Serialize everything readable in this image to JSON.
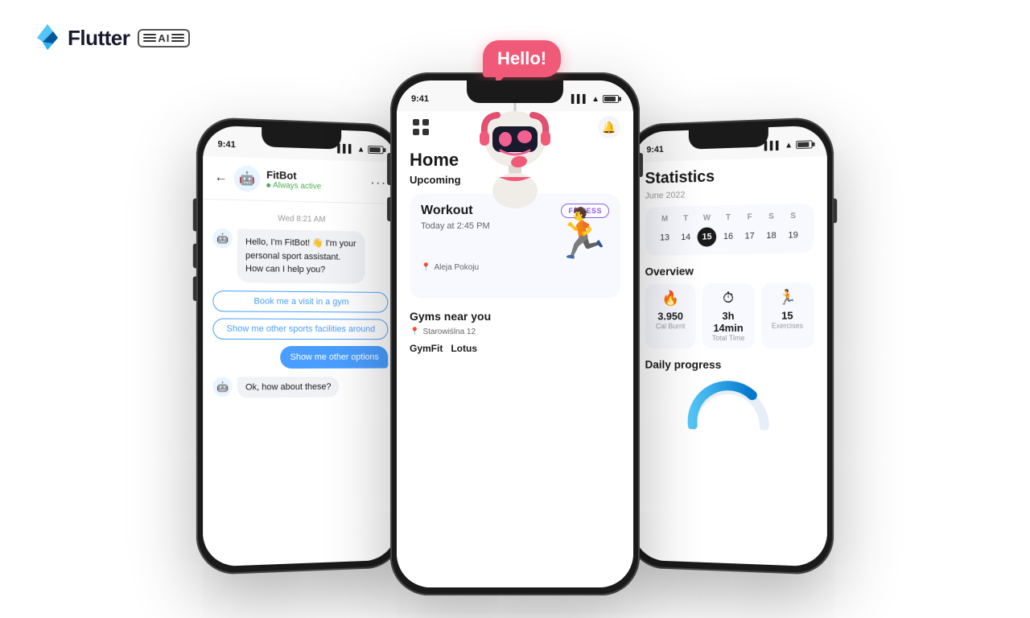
{
  "brand": {
    "name": "Flutter",
    "ai_label": "AI"
  },
  "phones": {
    "left": {
      "status_time": "9:41",
      "chat": {
        "contact_name": "FitBot",
        "contact_status": "Always active",
        "date_label": "Wed 8:21 AM",
        "bot_message": "Hello, I'm FitBot! 👋 I'm your personal sport assistant. How can I help you?",
        "option1": "Book me a visit in a gym",
        "option2": "Show me other sports facilities around",
        "user_message": "Show me other options",
        "bot_reply": "Ok, how about these?"
      }
    },
    "center": {
      "status_time": "9:41",
      "home": {
        "title": "Home",
        "section_upcoming": "Upcoming",
        "workout_title": "Workout",
        "workout_time": "Today at 2:45 PM",
        "fitness_badge": "FITNESS",
        "workout_location": "Aleja Pokoju",
        "gyms_section": "Gyms near you",
        "gyms_address": "Starowiślna 12",
        "gym1": "GymFit",
        "gym2": "Lotus"
      }
    },
    "right": {
      "status_time": "9:41",
      "statistics": {
        "title": "Statistics",
        "month": "June 2022",
        "calendar": {
          "days_labels": [
            "M",
            "T",
            "W",
            "T",
            "F",
            "S",
            "S"
          ],
          "days": [
            "13",
            "14",
            "15",
            "16",
            "17",
            "18",
            "19"
          ],
          "today_index": 2
        },
        "overview_title": "Overview",
        "overview_items": [
          {
            "value": "3.950",
            "label": "Cal Burnt",
            "icon": "🔥"
          },
          {
            "value": "3h 14min",
            "label": "Total Time",
            "icon": "⏱"
          },
          {
            "value": "15",
            "label": "Exercises",
            "icon": "🏃"
          }
        ],
        "daily_progress_title": "Daily progress"
      }
    }
  },
  "robot": {
    "hello_text": "Hello!"
  }
}
